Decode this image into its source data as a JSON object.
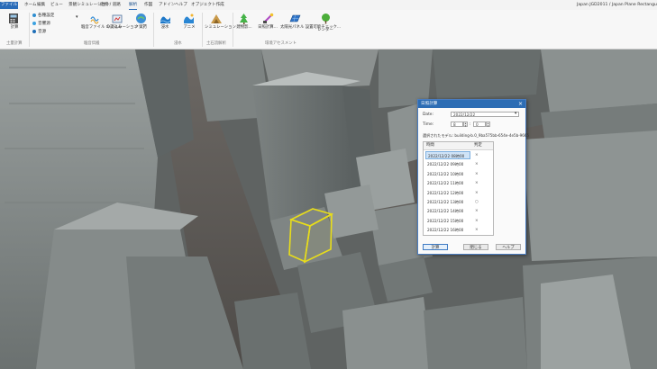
{
  "menu": {
    "file": "ファイル",
    "items": [
      "ホーム",
      "編集",
      "ビュー",
      "景観シミュレーション",
      "建物 / 道路",
      "解析",
      "作図",
      "アドイン",
      "ヘルプ",
      "オブジェクト作成"
    ],
    "active_index": 5,
    "right_info": "Japan    JGD2011 / Japan Plane Rectangular"
  },
  "ribbon": {
    "calc": {
      "label": "計算",
      "group": "土量計算"
    },
    "small_buttons": [
      {
        "label": "各種設定",
        "color": "#2f8ed0"
      },
      {
        "label": "音響源",
        "color": "#3aa1e0"
      },
      {
        "label": "音源",
        "color": "#1f6fb8"
      }
    ],
    "noise": {
      "btn1": "騒音ファイル の読込み",
      "btn2": "シミュレーション 実行",
      "btn3": "クリア",
      "group": "騒音伝搬"
    },
    "flood": {
      "btn1": "浸水",
      "btn2": "アニメ",
      "group": "浸水"
    },
    "sediment": {
      "btn1": "シミュレーション",
      "group": "土石流解析"
    },
    "solar": {
      "btn1": "建物影...",
      "btn2": "日照計算...",
      "btn3": "太陽光パネル 設置可能チェック...",
      "btn4": "レンダー",
      "group": "環境アセスメント"
    }
  },
  "dialog": {
    "title": "日照計算",
    "close": "×",
    "date_label": "Date:",
    "date_value": "2022/12/22",
    "time_label": "Time:",
    "time_hour": "8",
    "time_minute": "0",
    "object_info": "選択されたモデル: building-b.0_9ba575bb-654e-4e5b-9665",
    "table": {
      "col_time": "時間",
      "col_result": "判定",
      "rows": [
        {
          "time": "2022/12/22 08時00",
          "result": "×"
        },
        {
          "time": "2022/12/22 09時00",
          "result": "×"
        },
        {
          "time": "2022/12/22 10時00",
          "result": "×"
        },
        {
          "time": "2022/12/22 11時00",
          "result": "×"
        },
        {
          "time": "2022/12/22 12時00",
          "result": "×"
        },
        {
          "time": "2022/12/22 13時00",
          "result": "○"
        },
        {
          "time": "2022/12/22 14時00",
          "result": "×"
        },
        {
          "time": "2022/12/22 15時00",
          "result": "×"
        },
        {
          "time": "2022/12/22 16時00",
          "result": "×"
        }
      ],
      "selected_index": 0
    },
    "buttons": {
      "calc": "計算",
      "close": "閉じる",
      "help": "ヘルプ"
    }
  },
  "colors": {
    "accent": "#2d6db4",
    "highlight_building": "#e8dd1a"
  }
}
